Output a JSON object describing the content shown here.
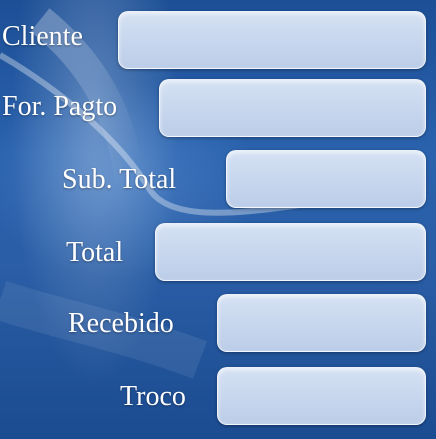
{
  "form": {
    "cliente_label": "Cliente",
    "cliente_value": "",
    "forma_pagto_label": "For. Pagto",
    "forma_pagto_value": "",
    "subtotal_label": "Sub. Total",
    "subtotal_value": "",
    "total_label": "Total",
    "total_value": "",
    "recebido_label": "Recebido",
    "recebido_value": "",
    "troco_label": "Troco",
    "troco_value": ""
  },
  "colors": {
    "background": "#2a62ad",
    "field": "#c7d6ee",
    "label": "#ffffff"
  }
}
